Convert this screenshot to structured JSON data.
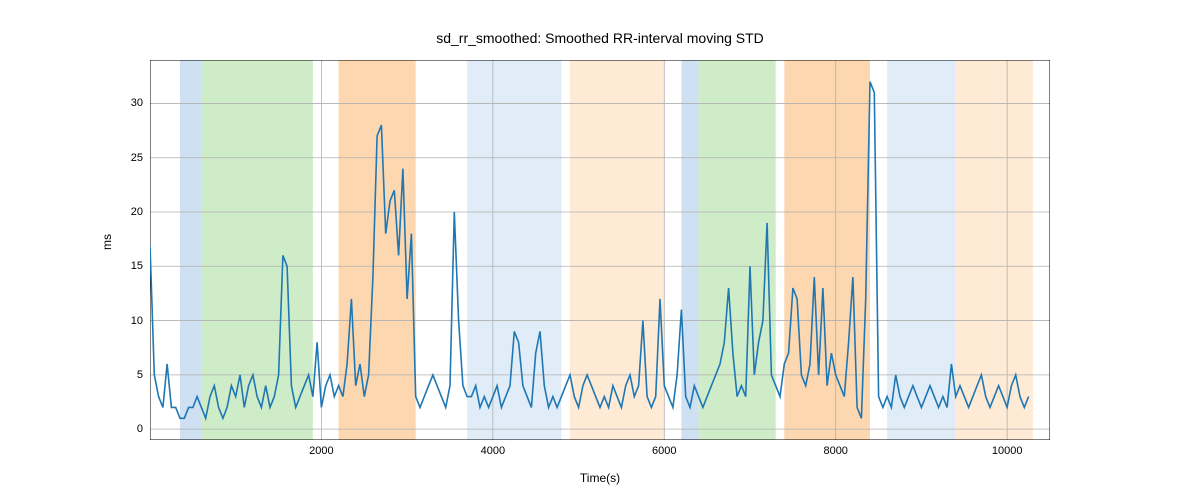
{
  "chart_data": {
    "type": "line",
    "title": "sd_rr_smoothed: Smoothed RR-interval moving STD",
    "xlabel": "Time(s)",
    "ylabel": "ms",
    "xlim": [
      0,
      10500
    ],
    "ylim": [
      -1,
      34
    ],
    "x_ticks": [
      2000,
      4000,
      6000,
      8000,
      10000
    ],
    "y_ticks": [
      0,
      5,
      10,
      15,
      20,
      25,
      30
    ],
    "regions": [
      {
        "start": 350,
        "end": 600,
        "color": "#c6dbef"
      },
      {
        "start": 600,
        "end": 1900,
        "color": "#c7e9c0"
      },
      {
        "start": 2200,
        "end": 3100,
        "color": "#fdd0a2"
      },
      {
        "start": 3700,
        "end": 4800,
        "color": "#dbe9f6"
      },
      {
        "start": 4900,
        "end": 6000,
        "color": "#fee6ce"
      },
      {
        "start": 6200,
        "end": 6400,
        "color": "#c6dbef"
      },
      {
        "start": 6400,
        "end": 7300,
        "color": "#c7e9c0"
      },
      {
        "start": 7400,
        "end": 8400,
        "color": "#fdd0a2"
      },
      {
        "start": 8600,
        "end": 9400,
        "color": "#dbe9f6"
      },
      {
        "start": 9400,
        "end": 10300,
        "color": "#fee6ce"
      }
    ],
    "x": [
      0,
      50,
      100,
      150,
      200,
      250,
      300,
      350,
      400,
      450,
      500,
      550,
      600,
      650,
      700,
      750,
      800,
      850,
      900,
      950,
      1000,
      1050,
      1100,
      1150,
      1200,
      1250,
      1300,
      1350,
      1400,
      1450,
      1500,
      1550,
      1600,
      1650,
      1700,
      1750,
      1800,
      1850,
      1900,
      1950,
      2000,
      2050,
      2100,
      2150,
      2200,
      2250,
      2300,
      2350,
      2400,
      2450,
      2500,
      2550,
      2600,
      2650,
      2700,
      2750,
      2800,
      2850,
      2900,
      2950,
      3000,
      3050,
      3100,
      3150,
      3200,
      3250,
      3300,
      3350,
      3400,
      3450,
      3500,
      3550,
      3600,
      3650,
      3700,
      3750,
      3800,
      3850,
      3900,
      3950,
      4000,
      4050,
      4100,
      4150,
      4200,
      4250,
      4300,
      4350,
      4400,
      4450,
      4500,
      4550,
      4600,
      4650,
      4700,
      4750,
      4800,
      4850,
      4900,
      4950,
      5000,
      5050,
      5100,
      5150,
      5200,
      5250,
      5300,
      5350,
      5400,
      5450,
      5500,
      5550,
      5600,
      5650,
      5700,
      5750,
      5800,
      5850,
      5900,
      5950,
      6000,
      6050,
      6100,
      6150,
      6200,
      6250,
      6300,
      6350,
      6400,
      6450,
      6500,
      6550,
      6600,
      6650,
      6700,
      6750,
      6800,
      6850,
      6900,
      6950,
      7000,
      7050,
      7100,
      7150,
      7200,
      7250,
      7300,
      7350,
      7400,
      7450,
      7500,
      7550,
      7600,
      7650,
      7700,
      7750,
      7800,
      7850,
      7900,
      7950,
      8000,
      8050,
      8100,
      8150,
      8200,
      8250,
      8300,
      8350,
      8400,
      8450,
      8500,
      8550,
      8600,
      8650,
      8700,
      8750,
      8800,
      8850,
      8900,
      8950,
      9000,
      9050,
      9100,
      9150,
      9200,
      9250,
      9300,
      9350,
      9400,
      9450,
      9500,
      9550,
      9600,
      9650,
      9700,
      9750,
      9800,
      9850,
      9900,
      9950,
      10000,
      10050,
      10100,
      10150,
      10200,
      10250
    ],
    "y": [
      17,
      5,
      3,
      2,
      6,
      2,
      2,
      1,
      1,
      2,
      2,
      3,
      2,
      1,
      3,
      4,
      2,
      1,
      2,
      4,
      3,
      5,
      2,
      4,
      5,
      3,
      2,
      4,
      2,
      3,
      5,
      16,
      15,
      4,
      2,
      3,
      4,
      5,
      3,
      8,
      2,
      4,
      5,
      3,
      4,
      3,
      6,
      12,
      4,
      6,
      3,
      5,
      14,
      27,
      28,
      18,
      21,
      22,
      16,
      24,
      12,
      18,
      3,
      2,
      3,
      4,
      5,
      4,
      3,
      2,
      4,
      20,
      10,
      4,
      3,
      3,
      4,
      2,
      3,
      2,
      3,
      4,
      2,
      3,
      4,
      9,
      8,
      4,
      3,
      2,
      7,
      9,
      4,
      2,
      3,
      2,
      3,
      4,
      5,
      3,
      2,
      4,
      5,
      4,
      3,
      2,
      3,
      2,
      4,
      3,
      2,
      4,
      5,
      3,
      4,
      10,
      3,
      2,
      3,
      12,
      4,
      3,
      2,
      5,
      11,
      3,
      2,
      4,
      3,
      2,
      3,
      4,
      5,
      6,
      8,
      13,
      7,
      3,
      4,
      3,
      15,
      5,
      8,
      10,
      19,
      5,
      4,
      3,
      6,
      7,
      13,
      12,
      5,
      4,
      6,
      14,
      5,
      13,
      4,
      7,
      5,
      4,
      3,
      8,
      14,
      2,
      1,
      12,
      32,
      31,
      3,
      2,
      3,
      2,
      5,
      3,
      2,
      3,
      4,
      3,
      2,
      3,
      4,
      3,
      2,
      3,
      2,
      6,
      3,
      4,
      3,
      2,
      3,
      4,
      5,
      3,
      2,
      3,
      4,
      3,
      2,
      4,
      5,
      3,
      2,
      3
    ]
  }
}
